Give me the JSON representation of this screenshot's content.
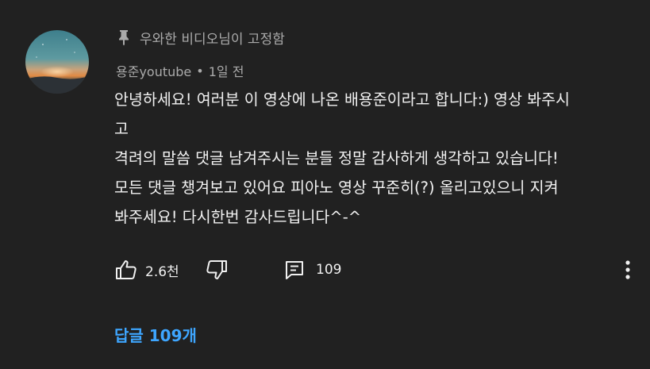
{
  "comment": {
    "pinned_label": "우와한 비디오님이 고정함",
    "author": "용준youtube",
    "separator": "•",
    "time_ago": "1일 전",
    "text": "안녕하세요! 여러분 이 영상에 나온 배용준이라고 합니다:) 영상 봐주시\n고\n격려의 말씀 댓글 남겨주시는 분들 정말 감사하게 생각하고 있습니다!\n모든 댓글 챙겨보고 있어요 피아노 영상 꾸준히(?) 올리고있으니 지켜\n봐주세요! 다시한번 감사드립니다^-^"
  },
  "actions": {
    "like_count": "2.6천",
    "reply_count": "109"
  },
  "replies": {
    "label": "답글 109개"
  },
  "icons": {
    "pin": "pin-icon",
    "like": "thumbs-up-icon",
    "dislike": "thumbs-down-icon",
    "reply": "comment-icon",
    "more": "more-vertical-icon"
  },
  "colors": {
    "background": "#212121",
    "text_primary": "#f1f1f1",
    "text_secondary": "#aaaaaa",
    "link": "#3ea6ff"
  }
}
